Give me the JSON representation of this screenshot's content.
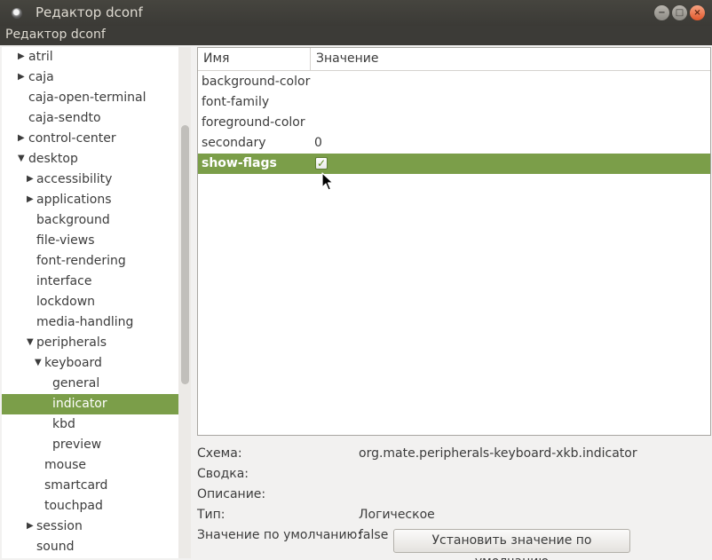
{
  "window": {
    "title": "Редактор dconf",
    "buttons": [
      "minimize-icon",
      "maximize-icon",
      "close-icon"
    ]
  },
  "menubar": {
    "label": "Редактор dconf"
  },
  "tree": {
    "items": [
      {
        "label": "atril",
        "level": 0,
        "arrow": "collapsed"
      },
      {
        "label": "caja",
        "level": 0,
        "arrow": "collapsed"
      },
      {
        "label": "caja-open-terminal",
        "level": 0,
        "arrow": "none"
      },
      {
        "label": "caja-sendto",
        "level": 0,
        "arrow": "none"
      },
      {
        "label": "control-center",
        "level": 0,
        "arrow": "collapsed"
      },
      {
        "label": "desktop",
        "level": 0,
        "arrow": "expanded"
      },
      {
        "label": "accessibility",
        "level": 1,
        "arrow": "collapsed"
      },
      {
        "label": "applications",
        "level": 1,
        "arrow": "collapsed"
      },
      {
        "label": "background",
        "level": 1,
        "arrow": "none"
      },
      {
        "label": "file-views",
        "level": 1,
        "arrow": "none"
      },
      {
        "label": "font-rendering",
        "level": 1,
        "arrow": "none"
      },
      {
        "label": "interface",
        "level": 1,
        "arrow": "none"
      },
      {
        "label": "lockdown",
        "level": 1,
        "arrow": "none"
      },
      {
        "label": "media-handling",
        "level": 1,
        "arrow": "none"
      },
      {
        "label": "peripherals",
        "level": 1,
        "arrow": "expanded"
      },
      {
        "label": "keyboard",
        "level": 2,
        "arrow": "expanded"
      },
      {
        "label": "general",
        "level": 3,
        "arrow": "none"
      },
      {
        "label": "indicator",
        "level": 3,
        "arrow": "none",
        "selected": true
      },
      {
        "label": "kbd",
        "level": 3,
        "arrow": "none"
      },
      {
        "label": "preview",
        "level": 3,
        "arrow": "none"
      },
      {
        "label": "mouse",
        "level": 2,
        "arrow": "none"
      },
      {
        "label": "smartcard",
        "level": 2,
        "arrow": "none"
      },
      {
        "label": "touchpad",
        "level": 2,
        "arrow": "none"
      },
      {
        "label": "session",
        "level": 1,
        "arrow": "collapsed"
      },
      {
        "label": "sound",
        "level": 1,
        "arrow": "none"
      }
    ]
  },
  "keys": {
    "columns": {
      "name": "Имя",
      "value": "Значение"
    },
    "rows": [
      {
        "name": "background-color",
        "value": ""
      },
      {
        "name": "font-family",
        "value": ""
      },
      {
        "name": "foreground-color",
        "value": ""
      },
      {
        "name": "secondary",
        "value": "0"
      },
      {
        "name": "show-flags",
        "value": "",
        "checkbox": true,
        "checked": true,
        "selected": true
      }
    ]
  },
  "details": {
    "schema_label": "Схема:",
    "schema_value": "org.mate.peripherals-keyboard-xkb.indicator",
    "summary_label": "Сводка:",
    "description_label": "Описание:",
    "type_label": "Тип:",
    "type_value": "Логическое",
    "default_label": "Значение по умолчанию:",
    "default_value": "false",
    "reset_button": "Установить значение по умолчанию"
  },
  "colors": {
    "selection": "#7b9e49",
    "titlebar": "#3c3b37"
  }
}
